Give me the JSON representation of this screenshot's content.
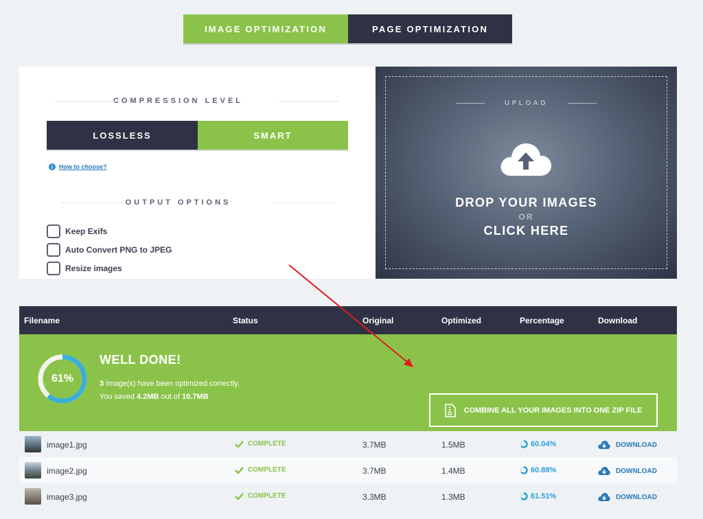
{
  "mode_tabs": {
    "image": "IMAGE OPTIMIZATION",
    "page": "PAGE OPTIMIZATION"
  },
  "compression": {
    "heading": "COMPRESSION LEVEL",
    "lossless": "LOSSLESS",
    "smart": "SMART",
    "selected": "SMART",
    "how_to_choose": "How to choose?"
  },
  "output": {
    "heading": "OUTPUT OPTIONS",
    "options": [
      "Keep Exifs",
      "Auto Convert PNG to JPEG",
      "Resize images"
    ]
  },
  "upload": {
    "label": "UPLOAD",
    "drop": "DROP YOUR IMAGES",
    "or": "OR",
    "click": "CLICK HERE"
  },
  "table": {
    "headers": {
      "filename": "Filename",
      "status": "Status",
      "original": "Original",
      "optimized": "Optimized",
      "percentage": "Percentage",
      "download": "Download"
    },
    "summary": {
      "progress": "61%",
      "progress_value": 61,
      "title": "WELL DONE!",
      "count": "3",
      "count_text": " Image(s) have been optimized correctly.",
      "saved_prefix": "You saved ",
      "saved": "4.2MB",
      "saved_mid": " out of ",
      "total": "10.7MB",
      "zip_button": "COMBINE ALL YOUR IMAGES INTO ONE ZIP FILE"
    },
    "rows": [
      {
        "filename": "image1.jpg",
        "status": "COMPLETE",
        "original": "3.7MB",
        "optimized": "1.5MB",
        "percentage": "60.04%",
        "download": "DOWNLOAD"
      },
      {
        "filename": "image2.jpg",
        "status": "COMPLETE",
        "original": "3.7MB",
        "optimized": "1.4MB",
        "percentage": "60.88%",
        "download": "DOWNLOAD"
      },
      {
        "filename": "image3.jpg",
        "status": "COMPLETE",
        "original": "3.3MB",
        "optimized": "1.3MB",
        "percentage": "61.51%",
        "download": "DOWNLOAD"
      }
    ]
  },
  "colors": {
    "accent_green": "#8bc34a",
    "dark_navy": "#2f3244",
    "link_blue": "#2a7ab8",
    "annotation_red": "#e01b1b"
  }
}
